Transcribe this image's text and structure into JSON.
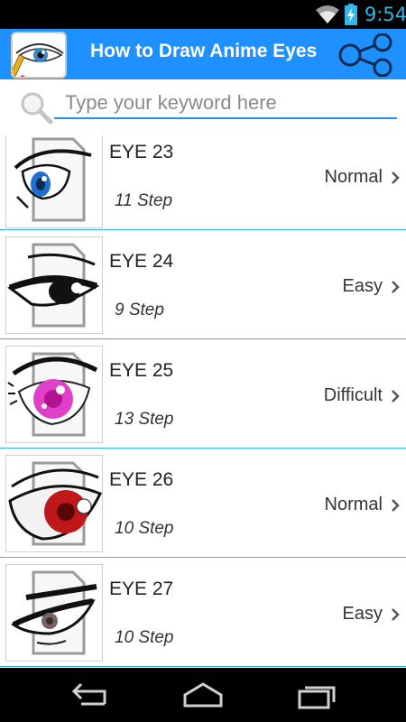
{
  "status_bar": {
    "time": "9:54",
    "icons": [
      "wifi-icon",
      "battery-charging-icon"
    ]
  },
  "app_bar": {
    "title": "How to Draw Anime Eyes",
    "icon": "eye-drawing-app-icon",
    "share_icon": "share-icon"
  },
  "search": {
    "placeholder": "Type your keyword here",
    "value": "",
    "icon": "search-icon"
  },
  "items": [
    {
      "name": "EYE 23",
      "steps": "11 Step",
      "level": "Normal",
      "iris_color": "#1e6fd0"
    },
    {
      "name": "EYE 24",
      "steps": "9 Step",
      "level": "Easy",
      "iris_color": "#111111"
    },
    {
      "name": "EYE 25",
      "steps": "13 Step",
      "level": "Difficult",
      "iris_color": "#e040c8"
    },
    {
      "name": "EYE 26",
      "steps": "10 Step",
      "level": "Normal",
      "iris_color": "#c01818"
    },
    {
      "name": "EYE 27",
      "steps": "10 Step",
      "level": "Easy",
      "iris_color": "#7a6060"
    }
  ],
  "nav_bar": {
    "buttons": [
      "back-icon",
      "home-icon",
      "recents-icon"
    ]
  },
  "colors": {
    "action_bar": "#1e90ff",
    "divider": "#33b5e5",
    "clock": "#33b5e5"
  }
}
